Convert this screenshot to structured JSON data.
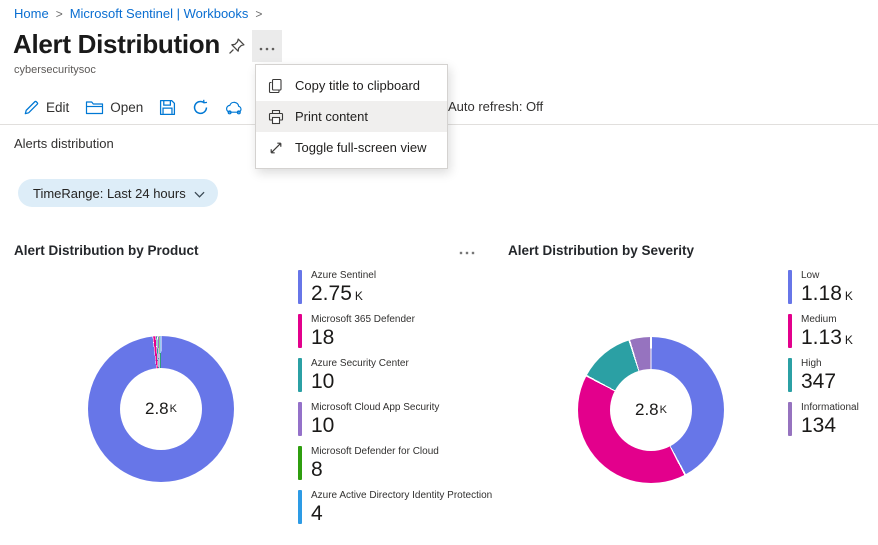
{
  "breadcrumb": {
    "items": [
      "Home",
      "Microsoft Sentinel | Workbooks"
    ],
    "separator": ">"
  },
  "header": {
    "title": "Alert Distribution",
    "subtitle": "cybersecuritysoc"
  },
  "toolbar": {
    "edit_label": "Edit",
    "open_label": "Open",
    "auto_refresh_label": "Auto refresh: Off"
  },
  "context_menu": {
    "hover_index": 1,
    "items": [
      {
        "icon": "copy-icon",
        "label": "Copy title to clipboard"
      },
      {
        "icon": "print-icon",
        "label": "Print content"
      },
      {
        "icon": "fullscreen-icon",
        "label": "Toggle full-screen view"
      }
    ]
  },
  "section_label": "Alerts distribution",
  "time_range_pill": "TimeRange: Last 24 hours",
  "colors": {
    "accent": "#0078d4",
    "link": "#0a6ed1"
  },
  "charts": [
    {
      "title": "Alert Distribution by Product",
      "donut": {
        "center_value": "2.8",
        "center_suffix": "K",
        "gap_deg": 0.5
      },
      "legend": [
        {
          "label": "Azure Sentinel",
          "value": "2.75",
          "suffix": "K",
          "numeric": 2750,
          "color": "#6776e8"
        },
        {
          "label": "Microsoft 365 Defender",
          "value": "18",
          "suffix": "",
          "numeric": 18,
          "color": "#e3008c"
        },
        {
          "label": "Azure Security Center",
          "value": "10",
          "suffix": "",
          "numeric": 10,
          "color": "#2ba0a4"
        },
        {
          "label": "Microsoft Cloud App Security",
          "value": "10",
          "suffix": "",
          "numeric": 10,
          "color": "#9471c9"
        },
        {
          "label": "Microsoft Defender for Cloud",
          "value": "8",
          "suffix": "",
          "numeric": 8,
          "color": "#2f9e0f"
        },
        {
          "label": "Azure Active Directory Identity Protection",
          "value": "4",
          "suffix": "",
          "numeric": 4,
          "color": "#2d9be5"
        }
      ]
    },
    {
      "title": "Alert Distribution by Severity",
      "donut": {
        "center_value": "2.8",
        "center_suffix": "K",
        "gap_deg": 1.4
      },
      "legend": [
        {
          "label": "Low",
          "value": "1.18",
          "suffix": "K",
          "numeric": 1180,
          "color": "#6776e8"
        },
        {
          "label": "Medium",
          "value": "1.13",
          "suffix": "K",
          "numeric": 1130,
          "color": "#e3008c"
        },
        {
          "label": "High",
          "value": "347",
          "suffix": "",
          "numeric": 347,
          "color": "#2ba0a4"
        },
        {
          "label": "Informational",
          "value": "134",
          "suffix": "",
          "numeric": 134,
          "color": "#9673bf"
        }
      ]
    }
  ],
  "chart_data": [
    {
      "type": "pie",
      "donut": true,
      "title": "Alert Distribution by Product",
      "labels": [
        "Azure Sentinel",
        "Microsoft 365 Defender",
        "Azure Security Center",
        "Microsoft Cloud App Security",
        "Microsoft Defender for Cloud",
        "Azure Active Directory Identity Protection"
      ],
      "values": [
        2750,
        18,
        10,
        10,
        8,
        4
      ],
      "value_labels": [
        "2.75 K",
        "18",
        "10",
        "10",
        "8",
        "4"
      ],
      "colors": [
        "#6776e8",
        "#e3008c",
        "#2ba0a4",
        "#9471c9",
        "#2f9e0f",
        "#2d9be5"
      ],
      "center_label": "2.8K",
      "legend_position": "right",
      "start_angle_deg": 0,
      "direction": "clockwise"
    },
    {
      "type": "pie",
      "donut": true,
      "title": "Alert Distribution by Severity",
      "labels": [
        "Low",
        "Medium",
        "High",
        "Informational"
      ],
      "values": [
        1180,
        1130,
        347,
        134
      ],
      "value_labels": [
        "1.18 K",
        "1.13 K",
        "347",
        "134"
      ],
      "colors": [
        "#6776e8",
        "#e3008c",
        "#2ba0a4",
        "#9673bf"
      ],
      "center_label": "2.8K",
      "legend_position": "right",
      "start_angle_deg": 0,
      "direction": "clockwise"
    }
  ]
}
